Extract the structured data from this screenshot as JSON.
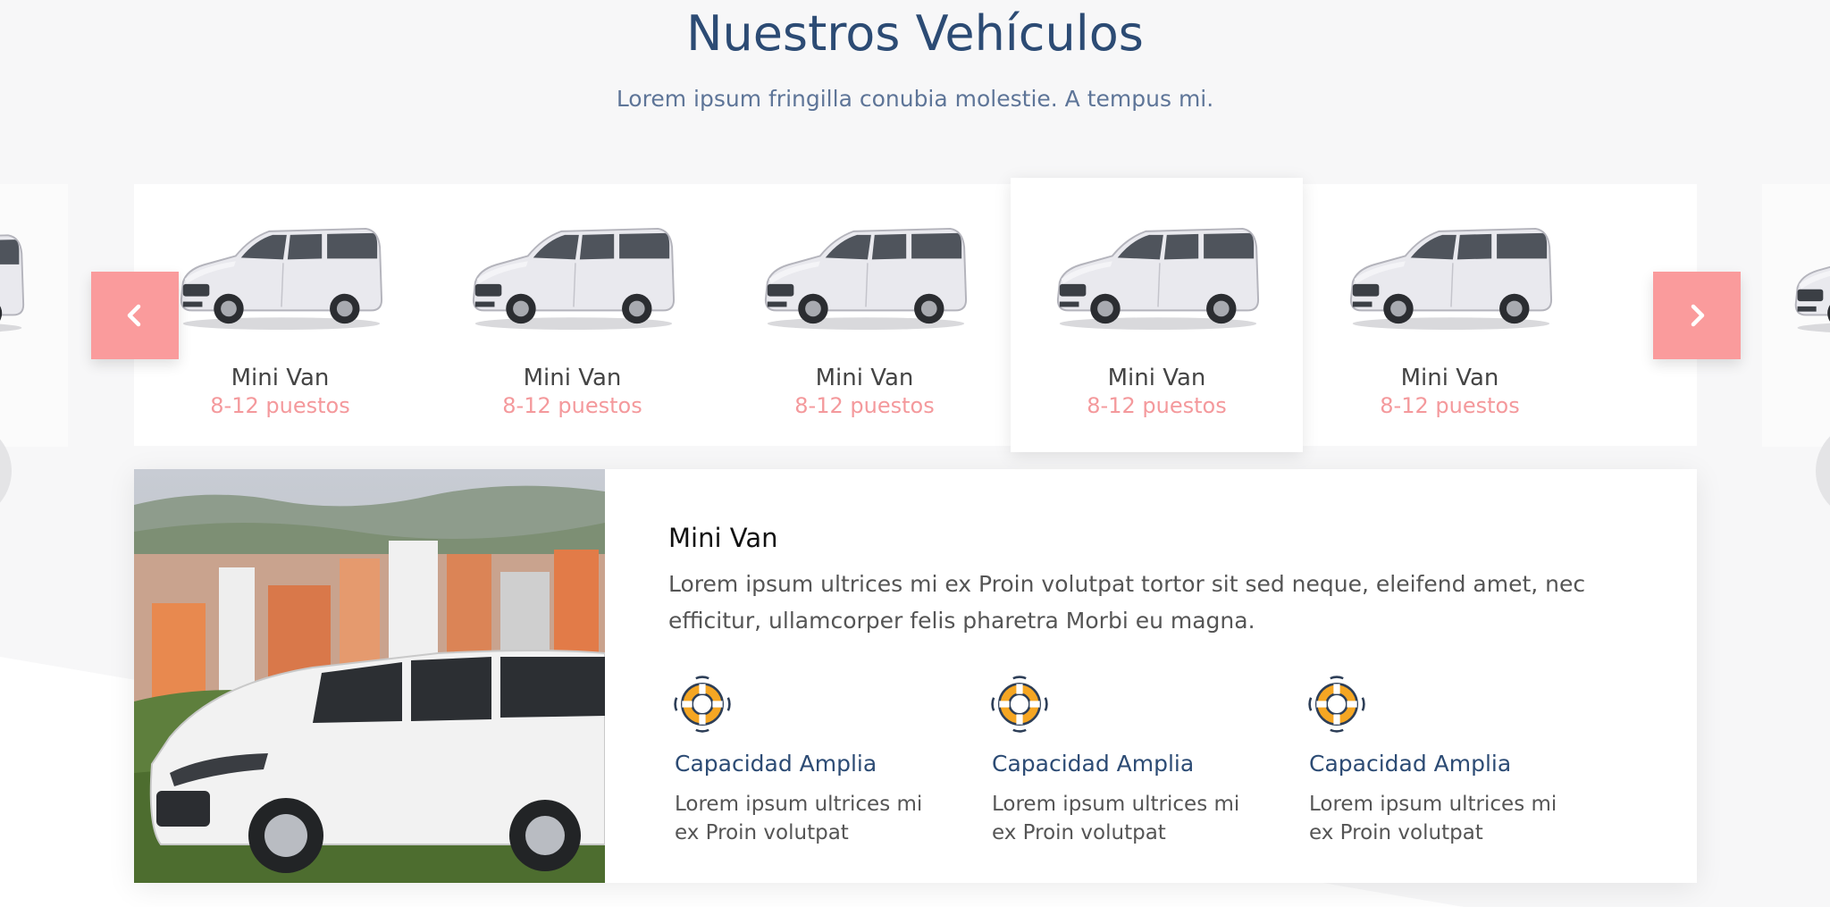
{
  "section": {
    "title": "Nuestros Vehículos",
    "subtitle": "Lorem ipsum fringilla conubia molestie. A tempus mi."
  },
  "carousel": {
    "prev_icon": "chevron-left-icon",
    "next_icon": "chevron-right-icon",
    "active_index": 3,
    "slides": [
      {
        "name": "Mini Van",
        "seats": "8-12 puestos"
      },
      {
        "name": "Mini Van",
        "seats": "8-12 puestos"
      },
      {
        "name": "Mini Van",
        "seats": "8-12 puestos"
      },
      {
        "name": "Mini Van",
        "seats": "8-12 puestos"
      },
      {
        "name": "Mini Van",
        "seats": "8-12 puestos"
      }
    ]
  },
  "detail": {
    "title": "Mini Van",
    "description": "Lorem ipsum ultrices mi ex Proin volutpat tortor sit sed neque, eleifend amet, nec efficitur, ullamcorper felis pharetra Morbi eu magna.",
    "features": [
      {
        "icon": "lifebuoy-icon",
        "title": "Capacidad Amplia",
        "text": "Lorem ipsum ultrices mi ex Proin volutpat"
      },
      {
        "icon": "lifebuoy-icon",
        "title": "Capacidad Amplia",
        "text": "Lorem ipsum ultrices mi ex Proin volutpat"
      },
      {
        "icon": "lifebuoy-icon",
        "title": "Capacidad Amplia",
        "text": "Lorem ipsum ultrices mi ex Proin volutpat"
      }
    ]
  },
  "colors": {
    "heading": "#2c4b74",
    "accent": "#fa9b9c",
    "seats_text": "#f4999c",
    "lifebuoy_orange": "#f5a623"
  }
}
